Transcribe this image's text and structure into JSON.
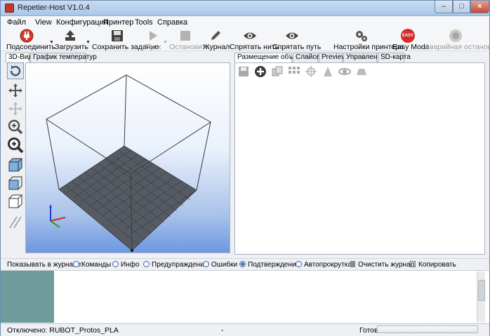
{
  "window": {
    "title": "Repetier-Host V1.0.4"
  },
  "menu": [
    "Файл",
    "View",
    "Конфигурация",
    "Принтер",
    "Tools",
    "Справка"
  ],
  "toolbar": {
    "connect": "Подсоединить",
    "load": "Загрузить",
    "save_job": "Сохранить задание",
    "run": "Пуск",
    "stop": "Остановить",
    "log": "Журнал",
    "hide_filament": "Спрятать нить",
    "hide_path": "Спрятать путь",
    "printer_settings": "Настройки принтера",
    "easy_mode": "Easy Mode",
    "easy_badge": "EASY",
    "emergency_stop": "Аварийная остановка"
  },
  "left_tabs": [
    "3D-Вид",
    "График температур"
  ],
  "right_tabs": [
    "Размещение объекта",
    "Слайсер",
    "Preview",
    "Управление",
    "SD-карта"
  ],
  "log_filter": {
    "label": "Показывать в журнале:",
    "commands": "Команды",
    "info": "Инфо",
    "warnings": "Предупраждения",
    "errors": "Ошибки",
    "confirm": "Подтверждение",
    "autoscroll": "Автопрокрутка",
    "clear_log": "Очистить журнал",
    "copy": "Копировать"
  },
  "status": {
    "connection": "Отключено: RUBOT_Protos_PLA",
    "mid": "-",
    "state": "Готов"
  },
  "colors": {
    "accent": "#c0392b",
    "easy_badge": "#d52b2b",
    "view_gradient_bottom": "#6d97e1",
    "log_block": "#6e9c9a"
  },
  "icons": {
    "connect": "power-plug-icon",
    "load": "upload-icon",
    "save": "floppy-disk-icon",
    "run": "play-icon",
    "stop": "stop-icon",
    "log": "pencil-icon",
    "hide_filament": "eye-icon",
    "hide_path": "eye-icon",
    "printer_settings": "gears-icon",
    "emergency": "emergency-icon"
  }
}
